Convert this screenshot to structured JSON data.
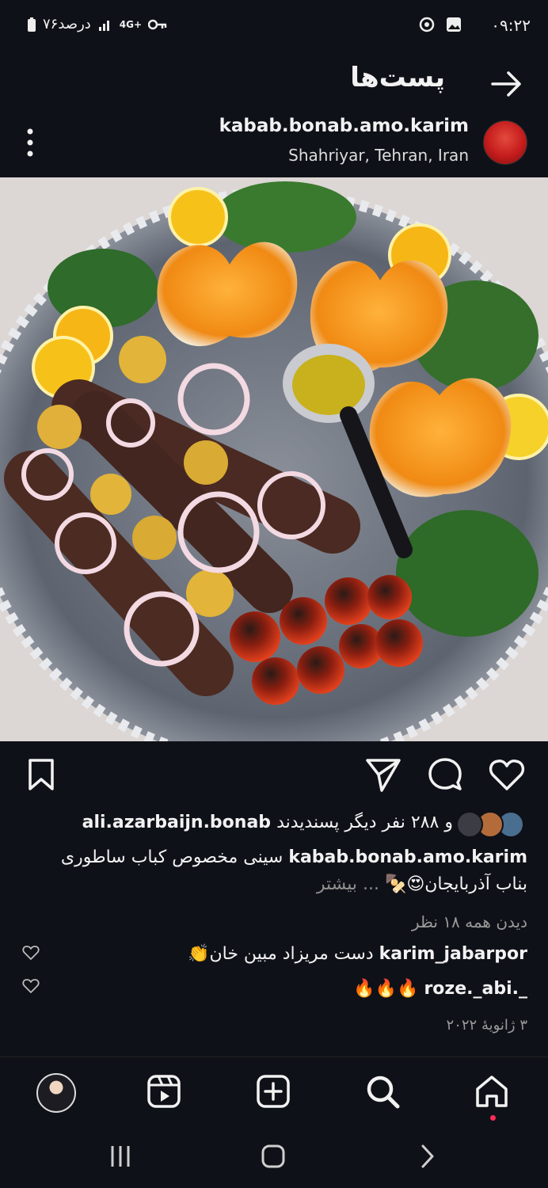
{
  "status": {
    "time": "۰۹:۲۲",
    "battery": "۷۶درصد",
    "network": "4G+"
  },
  "header": {
    "title": "پست‌ها"
  },
  "post": {
    "username": "kabab.bonab.amo.karim",
    "location": "Shahriyar, Tehran, Iran",
    "liked_by_user": "ali.azarbaijn.bonab",
    "likes_suffix": "و ۲۸۸ نفر دیگر پسندیدند",
    "caption_user": "kabab.bonab.amo.karim",
    "caption_line1": "سینی مخصوص کباب ساطوری",
    "caption_line2": "بناب آذربایجان😍🍢",
    "more_label": "... بیشتر",
    "views": "دیدن همه ۱۸ نظر",
    "date": "۳ ژانویهٔ ۲۰۲۲"
  },
  "comments": [
    {
      "user": "karim_jabarpor",
      "text": "دست مریزاد مبین خان👏"
    },
    {
      "user": "_.roze._abi",
      "text": "🔥🔥🔥"
    }
  ],
  "icons": {
    "back": "arrow-right-icon",
    "menu": "kebab-icon",
    "save": "bookmark-icon",
    "share": "send-icon",
    "comment": "comment-icon",
    "like": "heart-icon",
    "profile": "avatar",
    "reels": "reels-icon",
    "add": "add-icon",
    "search": "search-icon",
    "home": "home-icon"
  },
  "colors": {
    "background": "#0f1118",
    "notification_dot": "#ff2d55"
  }
}
